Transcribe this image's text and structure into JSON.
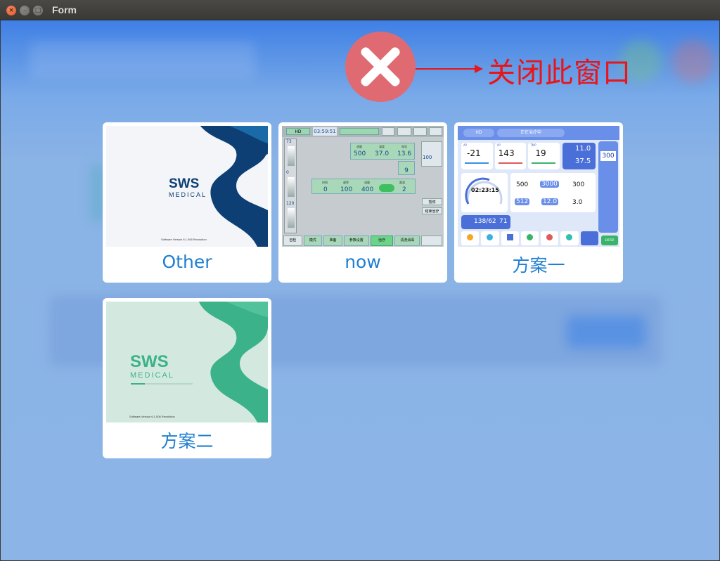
{
  "window": {
    "title": "Form",
    "buttons": {
      "close": "×",
      "minimize": "–",
      "maximize": "□"
    }
  },
  "close_hint": {
    "label": "关闭此窗口"
  },
  "cards": [
    {
      "label": "Other",
      "brand": "SWS",
      "brand_sub": "MEDICAL",
      "version": "Software Version 6.1.006 Revolution"
    },
    {
      "label": "now",
      "screen": {
        "mode": "HD",
        "time": "03:59:51",
        "values_top": [
          {
            "name": "流量",
            "value": "500"
          },
          {
            "name": "温度",
            "value": "37.0"
          },
          {
            "name": "电导",
            "value": "13.6"
          }
        ],
        "value_right": "9",
        "values_bottom": [
          {
            "name": "时间",
            "value": "0"
          },
          {
            "name": "速率",
            "value": "100"
          },
          {
            "name": "流量",
            "value": "400"
          },
          {
            "name": "超滤",
            "value": "2"
          }
        ],
        "side_top": "73",
        "side_mid": "0",
        "side_bottom": "120",
        "right_value": "100",
        "tabs": [
          "自检",
          "模式",
          "准备",
          "参数设置",
          "治疗",
          "清洗消毒"
        ],
        "right_buttons": [
          "暂停",
          "结束治疗"
        ]
      }
    },
    {
      "label": "方案一",
      "screen": {
        "mode": "HD",
        "status": "正在治疗中",
        "pressures": [
          {
            "name": "AP",
            "value": "-21"
          },
          {
            "name": "VP",
            "value": "143"
          },
          {
            "name": "TMP",
            "value": "19"
          }
        ],
        "cond": "11.0",
        "temp": "37.5",
        "remaining": "02:23:15",
        "stats": [
          {
            "value": "500",
            "highlight": false
          },
          {
            "value": "3000",
            "highlight": true
          },
          {
            "value": "300",
            "highlight": false
          },
          {
            "value": "512",
            "highlight": true
          },
          {
            "value": "12.0",
            "highlight": true
          },
          {
            "value": "3.0",
            "highlight": false
          }
        ],
        "bp": "138/62",
        "pulse": "71",
        "side_value": "300",
        "enter": "ENTER"
      }
    },
    {
      "label": "方案二",
      "brand": "SWS",
      "brand_sub": "MEDICAL",
      "version": "Software Version 6.1.006 Revolution"
    }
  ],
  "colors": {
    "accent_text": "#1f7fd0",
    "close_red": "#e8151a",
    "sws_navy": "#0e3f74",
    "sws_green": "#3cb28a"
  }
}
